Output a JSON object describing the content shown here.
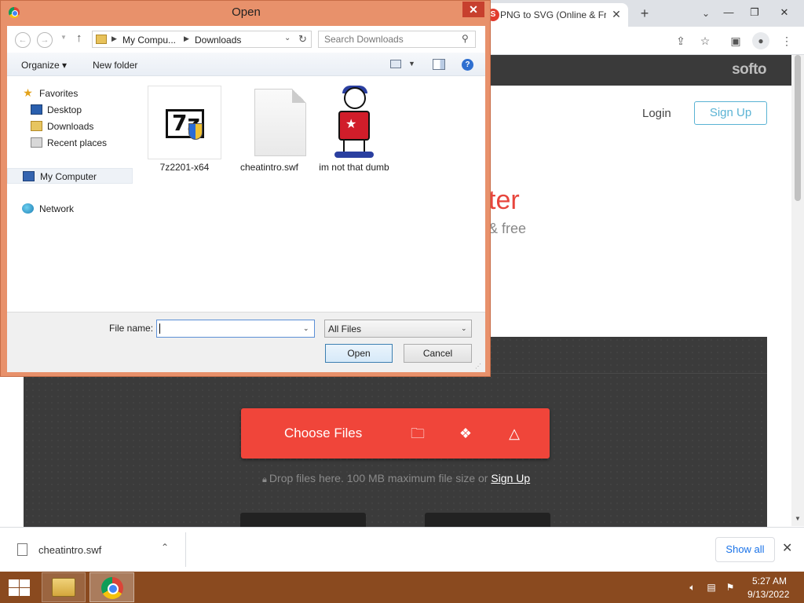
{
  "browser": {
    "tab_title": "PNG to SVG (Online & Fr",
    "tab_favicon_letter": "S",
    "new_tab": "+",
    "tab_close": "✕",
    "win_minimize": "—",
    "win_restore": "❐",
    "win_close": "✕"
  },
  "page": {
    "logo": "softo",
    "login": "Login",
    "signup": "Sign Up",
    "heading_partial": "ter",
    "subheading_partial": "& free",
    "choose_files": "Choose Files",
    "drop_text": "Drop files here. 100 MB maximum file size or",
    "drop_signup": "Sign Up"
  },
  "downloads": {
    "file_name": "cheatintro.swf",
    "show_all": "Show all"
  },
  "dialog": {
    "title": "Open",
    "close": "✕",
    "address": [
      "My Compu...",
      "Downloads"
    ],
    "search_placeholder": "Search Downloads",
    "organize": "Organize ▾",
    "new_folder": "New folder",
    "nav": {
      "favorites": "Favorites",
      "desktop": "Desktop",
      "downloads": "Downloads",
      "recent": "Recent places",
      "computer": "My Computer",
      "network": "Network"
    },
    "files": [
      "7z2201-x64",
      "cheatintro.swf",
      "im not that dumb"
    ],
    "file_name_label": "File name:",
    "file_name_value": "",
    "file_type": "All Files",
    "open": "Open",
    "cancel": "Cancel"
  },
  "taskbar": {
    "time": "5:27 AM",
    "date": "9/13/2022"
  }
}
